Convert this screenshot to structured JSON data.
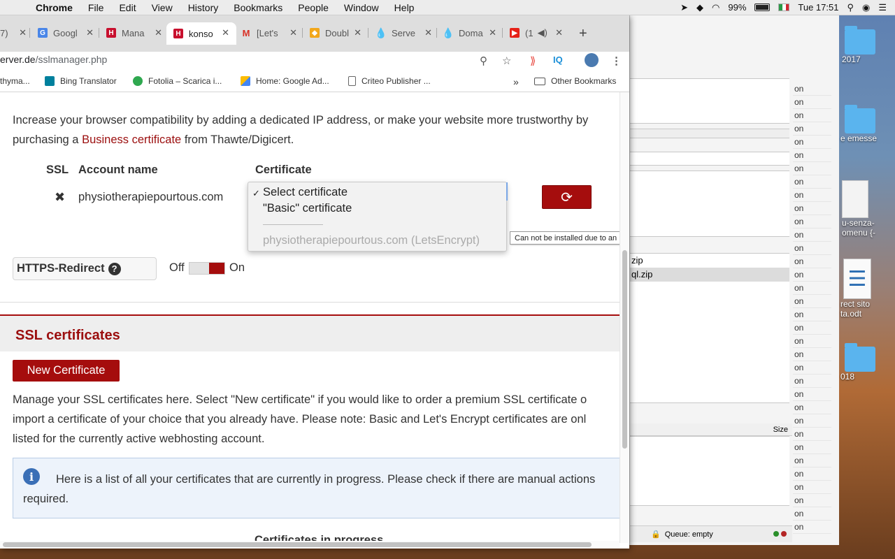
{
  "menubar": {
    "items": [
      "Chrome",
      "File",
      "Edit",
      "View",
      "History",
      "Bookmarks",
      "People",
      "Window",
      "Help"
    ],
    "battery": "99%",
    "clock": "Tue 17:51"
  },
  "tabs": [
    {
      "label": "7)",
      "favicon": "blank"
    },
    {
      "label": "Googl",
      "favicon": "google-translate-icon"
    },
    {
      "label": "Mana",
      "favicon": "hosting-h-icon"
    },
    {
      "label": "konso",
      "favicon": "hosting-h-icon",
      "active": true
    },
    {
      "label": "[Let's",
      "favicon": "gmail-icon"
    },
    {
      "label": "Doubl",
      "favicon": "doubleclick-icon"
    },
    {
      "label": "Serve",
      "favicon": "drop-icon"
    },
    {
      "label": "Doma",
      "favicon": "drop-icon"
    },
    {
      "label": "(1",
      "favicon": "youtube-icon"
    }
  ],
  "address": {
    "host": "erver.de",
    "path": "/sslmanager.php"
  },
  "bookmarks": [
    {
      "label": "thyma..."
    },
    {
      "label": "Bing Translator"
    },
    {
      "label": "Fotolia – Scarica i..."
    },
    {
      "label": "Home: Google Ad..."
    },
    {
      "label": "Criteo Publisher ..."
    }
  ],
  "bookmarks_more": "»",
  "other_bookmarks": "Other Bookmarks",
  "page": {
    "intro_line1": "Increase your browser compatibility by adding a dedicated IP address, or make your website more trustworthy by",
    "intro_pre": "purchasing a ",
    "intro_link": "Business certificate",
    "intro_post": " from Thawte/Digicert.",
    "table": {
      "col_ssl": "SSL",
      "col_account": "Account name",
      "col_certificate": "Certificate",
      "row_account": "physiotherapiepourtous.com"
    },
    "dropdown": {
      "options": [
        "Select certificate",
        "\"Basic\" certificate"
      ],
      "disabled_option": "physiotherapiepourtous.com (LetsEncrypt)"
    },
    "tooltip": "Can not be installed due to an invalid state.",
    "https_redirect": "HTTPS-Redirect",
    "toggle_off": "Off",
    "toggle_on": "On",
    "ssl_section_title": "SSL certificates",
    "new_certificate": "New Certificate",
    "manage_line1": "Manage your SSL certificates here. Select \"New certificate\" if you would like to order a premium SSL certificate o",
    "manage_line2": "import a certificate of your choice that you already have. Please note: Basic and Let's Encrypt certificates are onl",
    "manage_line3": "listed for the currently active webhosting account.",
    "info_text": "Here is a list of all your certificates that are currently in progress. Please check if there are manual actions required.",
    "in_progress_heading": "Certificates in progress"
  },
  "background_app": {
    "files": [
      "zip",
      "ql.zip"
    ],
    "size_header": "Size",
    "queue": "Queue: empty",
    "on_column": [
      "on",
      "on",
      "on",
      "on",
      "on",
      "on",
      "on",
      "on",
      "on",
      "on",
      "on",
      "on",
      "on",
      "on",
      "on",
      "on",
      "on",
      "on",
      "on",
      "on",
      "on",
      "on",
      "on",
      "on",
      "on",
      "on",
      "on",
      "on",
      "on",
      "on",
      "on",
      "on",
      "on",
      "on"
    ]
  },
  "desktop": {
    "labels": [
      "2017",
      "e emesse",
      "u-senza-\nomenu {-",
      "rect sito\nta.odt",
      "018"
    ]
  },
  "colors": {
    "brand_red": "#a50d0d",
    "link_red": "#9b0e0e",
    "info_blue": "#3a6fb6"
  }
}
